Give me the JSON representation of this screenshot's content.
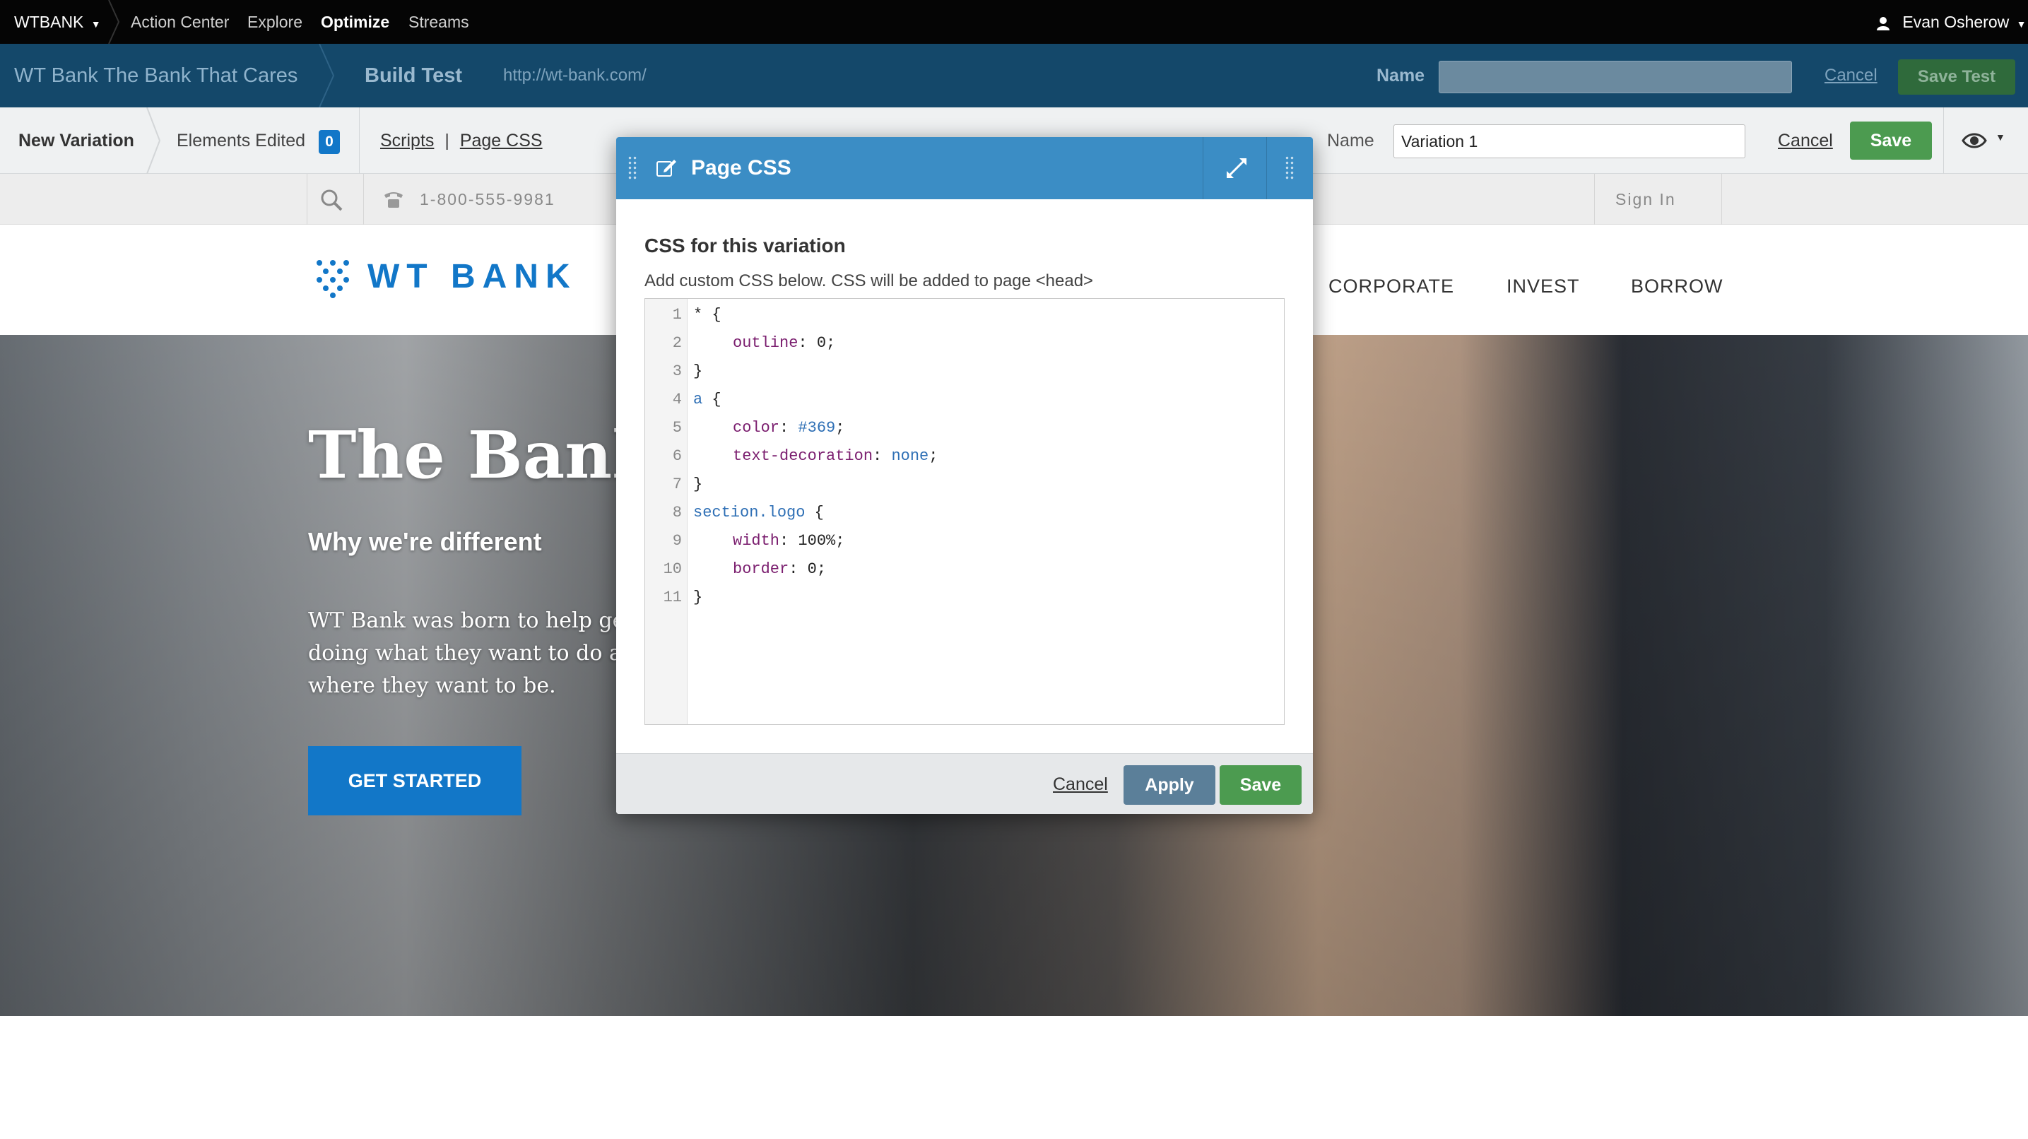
{
  "topnav": {
    "brand": "WTBANK",
    "items": [
      "Action Center",
      "Explore",
      "Optimize",
      "Streams"
    ],
    "user": "Evan Osherow"
  },
  "buildbar": {
    "site_name": "WT Bank The Bank That Cares",
    "step": "Build Test",
    "url": "http://wt-bank.com/",
    "name_label": "Name",
    "name_value": "",
    "cancel": "Cancel",
    "save_test": "Save Test"
  },
  "varbar": {
    "new_variation": "New Variation",
    "elements_edited": "Elements Edited",
    "elements_count": "0",
    "scripts": "Scripts",
    "divider": "|",
    "page_css": "Page CSS",
    "name_label": "Name",
    "name_value": "Variation 1",
    "cancel": "Cancel",
    "save": "Save"
  },
  "site": {
    "phone": "1-800-555-9981",
    "sign_in": "Sign In",
    "logo_text": "WT BANK",
    "nav": [
      "CORPORATE",
      "INVEST",
      "BORROW"
    ],
    "hero_title": "The Bank",
    "hero_subtitle": "Why we're different",
    "hero_body": [
      "WT Bank was born to help ge",
      "doing what they want to do a",
      "where they want to be."
    ],
    "cta": "GET STARTED"
  },
  "modal": {
    "title": "Page CSS",
    "heading": "CSS for this variation",
    "hint": "Add custom CSS below. CSS will be added to page <head>",
    "line_numbers": [
      "1",
      "2",
      "3",
      "4",
      "5",
      "6",
      "7",
      "8",
      "9",
      "10",
      "11"
    ],
    "code": {
      "l1_sel": "*",
      "l1_brace": " {",
      "l2_prop": "outline",
      "l2_rest": ": 0;",
      "l3": "}",
      "l4_sel": "a",
      "l4_brace": " {",
      "l5_prop": "color",
      "l5_colon": ": ",
      "l5_val": "#369",
      "l5_end": ";",
      "l6_prop": "text-decoration",
      "l6_colon": ": ",
      "l6_val": "none",
      "l6_end": ";",
      "l7": "}",
      "l8_sel": "section.logo",
      "l8_brace": " {",
      "l9_prop": "width",
      "l9_rest": ": 100%;",
      "l10_prop": "border",
      "l10_rest": ": 0;",
      "l11": "}"
    },
    "cancel": "Cancel",
    "apply": "Apply",
    "save": "Save"
  },
  "colors": {
    "topnav_bg": "#050505",
    "buildbar_bg": "#14486a",
    "modal_header": "#3b8dc5",
    "save_green": "#4c9b50",
    "apply_blue": "#5b7f99",
    "cta_blue": "#1277c8"
  }
}
